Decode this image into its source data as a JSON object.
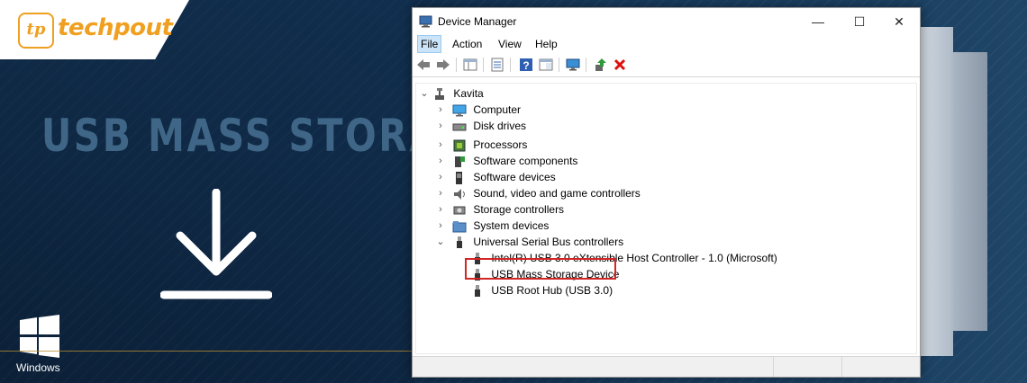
{
  "brand": {
    "logo_mark": "tp",
    "name": "techpout"
  },
  "headline": "USB MASS STORAGE",
  "os_label": "Windows",
  "window": {
    "title": "Device Manager",
    "menu": [
      "File",
      "Action",
      "View",
      "Help"
    ]
  },
  "tree": {
    "root": "Kavita",
    "categories": [
      {
        "label": "Computer",
        "icon": "monitor-icon"
      },
      {
        "label": "Disk drives",
        "icon": "disk-icon"
      },
      {
        "label": "Processors",
        "icon": "chip-icon"
      },
      {
        "label": "Software components",
        "icon": "puzzle-icon"
      },
      {
        "label": "Software devices",
        "icon": "device-icon"
      },
      {
        "label": "Sound, video and game controllers",
        "icon": "speaker-icon"
      },
      {
        "label": "Storage controllers",
        "icon": "storage-controller-icon"
      },
      {
        "label": "System devices",
        "icon": "folder-icon"
      },
      {
        "label": "Universal Serial Bus controllers",
        "icon": "usb-icon"
      }
    ],
    "usb_children": [
      "Intel(R) USB 3.0 eXtensible Host Controller - 1.0 (Microsoft)",
      "USB Mass Storage Device",
      "USB Root Hub (USB 3.0)"
    ],
    "selected": "USB Mass Storage Device"
  },
  "colors": {
    "accent_gold": "#f0a020",
    "highlight_red": "#d32525",
    "background_navy": "#0f2a48"
  }
}
